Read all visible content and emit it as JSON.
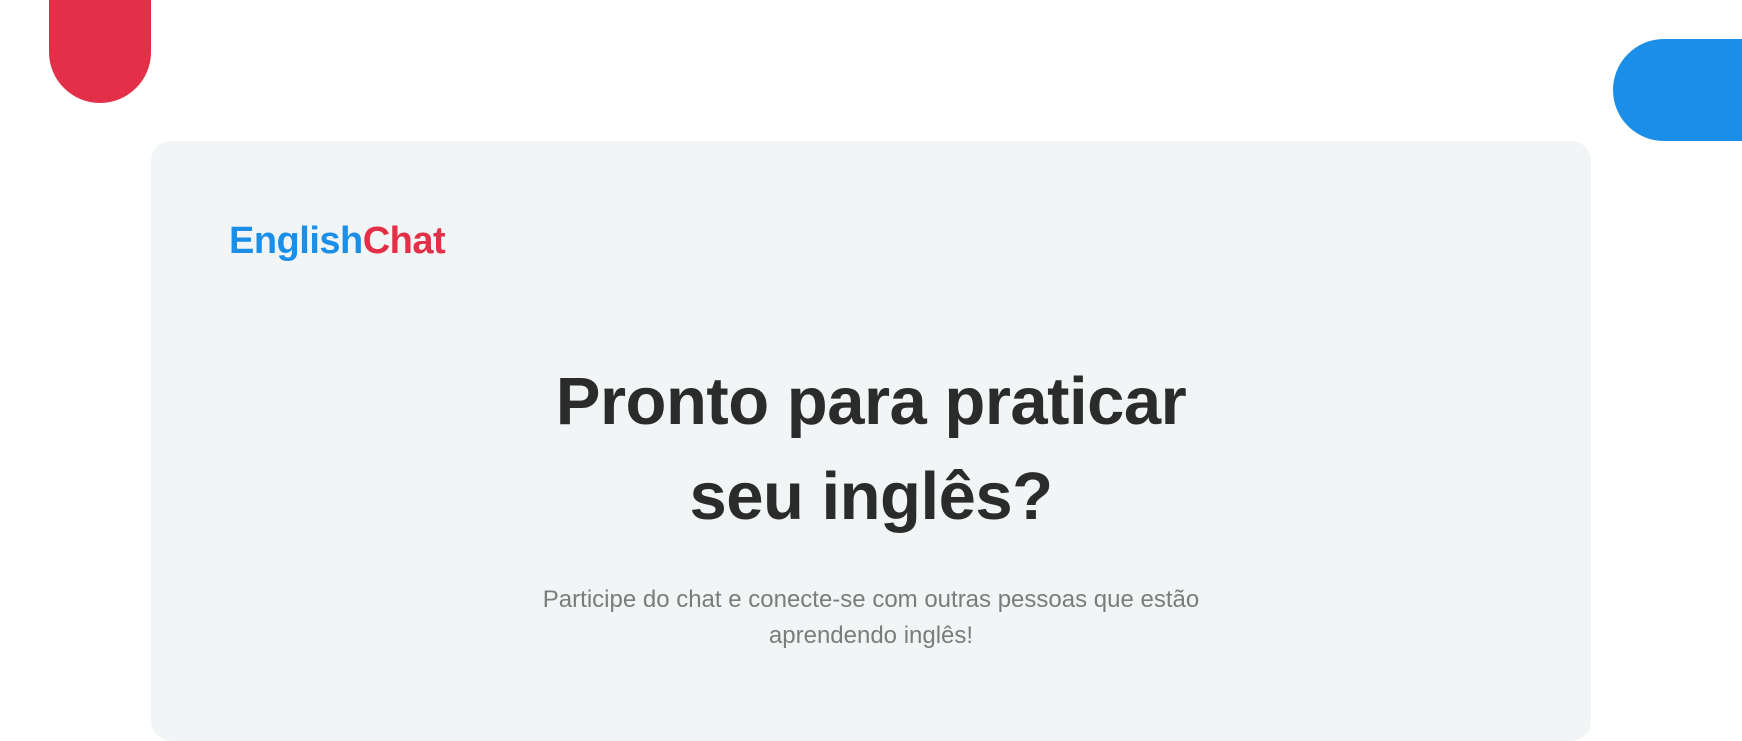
{
  "brand": {
    "name_part1": "English",
    "name_part2": "Chat",
    "color_primary": "#1b8fe8",
    "color_secondary": "#e42f48"
  },
  "hero": {
    "title": "Pronto para praticar seu inglês?",
    "subtitle": "Participe do chat e conecte-se com outras pessoas que estão aprendendo inglês!"
  },
  "colors": {
    "card_background": "#f1f5f6",
    "title_text": "#2b2b2b",
    "subtitle_text": "#7c7c7c"
  }
}
